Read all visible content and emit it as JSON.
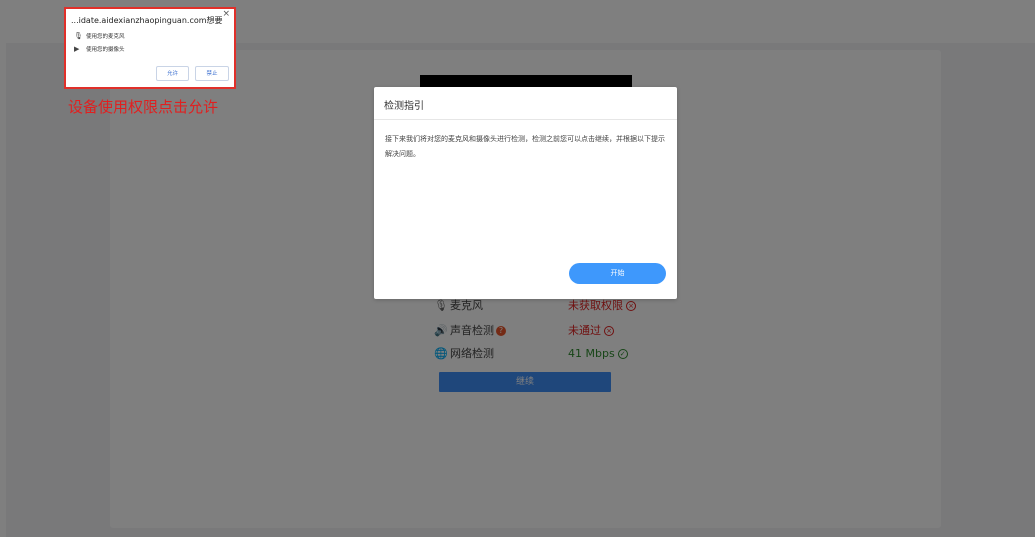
{
  "page": {
    "continue_label": "继续"
  },
  "checks": [
    {
      "icon": "microphone-icon",
      "label": "麦克风",
      "status": "未获取权限",
      "state": "fail"
    },
    {
      "icon": "speaker-icon",
      "label": "声音检测",
      "status": "未通过",
      "state": "fail",
      "has_help": true
    },
    {
      "icon": "globe-icon",
      "label": "网络检测",
      "status": "41 Mbps",
      "state": "pass"
    }
  ],
  "modal": {
    "title": "检测指引",
    "body": "接下来我们将对您的麦克风和摄像头进行检测，检测之前您可以点击继续，并根据以下提示解决问题。",
    "start_label": "开始"
  },
  "permission_popup": {
    "title": "...idate.aidexianzhaopinguan.com想要",
    "close": "×",
    "items": [
      "使用您的麦克风",
      "使用您的摄像头"
    ],
    "allow_label": "允许",
    "deny_label": "禁止"
  },
  "annotation": "设备使用权限点击允许",
  "colors": {
    "fail": "#e02020",
    "pass": "#2e8b2e",
    "primary": "#3e8ef7",
    "highlight_border": "#e0302a"
  }
}
